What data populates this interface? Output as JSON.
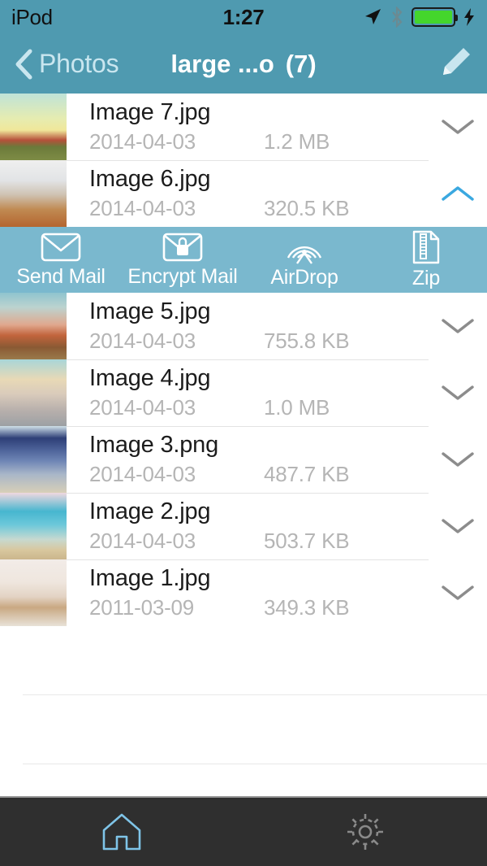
{
  "status_bar": {
    "carrier": "iPod",
    "time": "1:27",
    "icons": [
      "location-arrow-icon",
      "bluetooth-icon",
      "battery-icon",
      "charging-bolt-icon"
    ],
    "battery_color": "#44d62c"
  },
  "nav_bar": {
    "back_label": "Photos",
    "title": "large ...o",
    "count": "(7)",
    "edit_icon": "pencil-icon",
    "background": "#4f9ab0"
  },
  "files": [
    {
      "name": "Image 7.jpg",
      "date": "2014-04-03",
      "size": "1.2 MB",
      "expanded": false,
      "thumb": "field-trees"
    },
    {
      "name": "Image 6.jpg",
      "date": "2014-04-03",
      "size": "320.5 KB",
      "expanded": true,
      "thumb": "misty-grass"
    },
    {
      "name": "Image 5.jpg",
      "date": "2014-04-03",
      "size": "755.8 KB",
      "expanded": false,
      "thumb": "autumn-tree"
    },
    {
      "name": "Image 4.jpg",
      "date": "2014-04-03",
      "size": "1.0 MB",
      "expanded": false,
      "thumb": "hazy-city"
    },
    {
      "name": "Image 3.png",
      "date": "2014-04-03",
      "size": "487.7 KB",
      "expanded": false,
      "thumb": "paraglider"
    },
    {
      "name": "Image 2.jpg",
      "date": "2014-04-03",
      "size": "503.7 KB",
      "expanded": false,
      "thumb": "blossom-bench"
    },
    {
      "name": "Image 1.jpg",
      "date": "2011-03-09",
      "size": "349.3 KB",
      "expanded": false,
      "thumb": "pale-shore"
    }
  ],
  "action_bar": {
    "background": "#7ab8ce",
    "actions": [
      {
        "label": "Send Mail",
        "icon": "envelope-icon"
      },
      {
        "label": "Encrypt Mail",
        "icon": "envelope-lock-icon"
      },
      {
        "label": "AirDrop",
        "icon": "airdrop-icon"
      },
      {
        "label": "Zip",
        "icon": "zip-file-icon"
      }
    ]
  },
  "tab_bar": {
    "background": "#2f2f2f",
    "tabs": [
      {
        "icon": "home-icon",
        "active": true,
        "color": "#7fc4e8"
      },
      {
        "icon": "gear-icon",
        "active": false,
        "color": "#8a8a8a"
      }
    ]
  }
}
